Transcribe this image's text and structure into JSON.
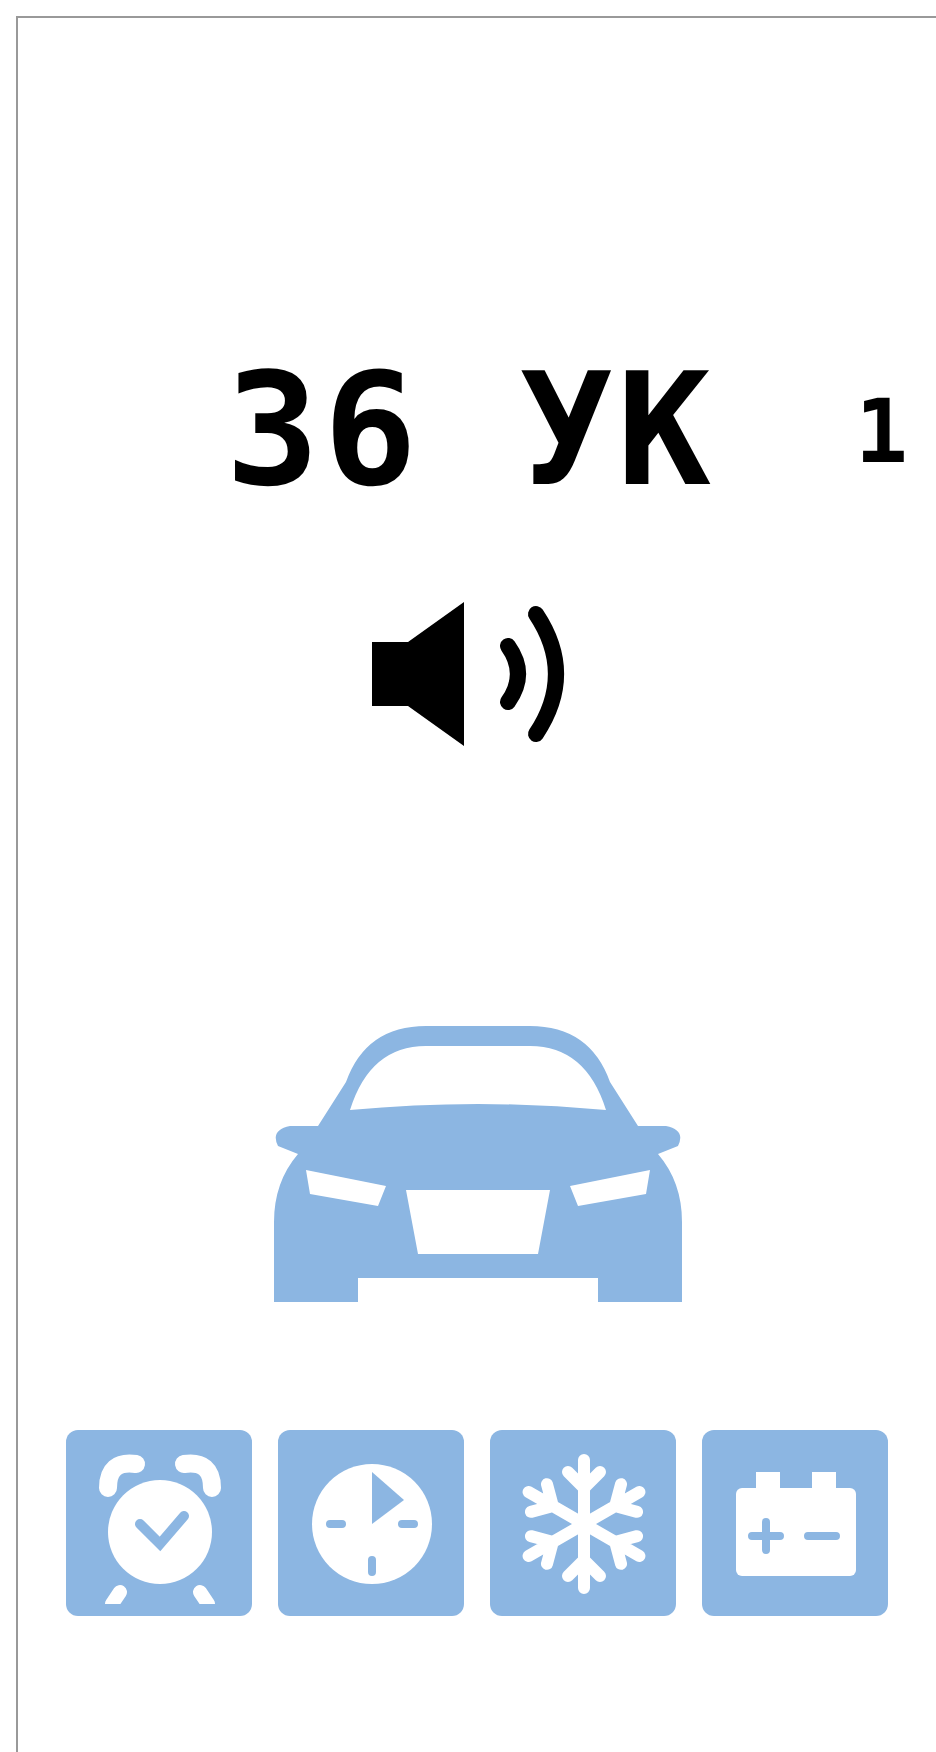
{
  "display": {
    "main": "36 УК",
    "side": "1"
  },
  "sound": {
    "on": true
  },
  "indicators": [
    {
      "kind": "alarm",
      "on": true
    },
    {
      "kind": "timer",
      "on": true
    },
    {
      "kind": "frost",
      "on": true
    },
    {
      "kind": "battery",
      "on": true
    }
  ]
}
